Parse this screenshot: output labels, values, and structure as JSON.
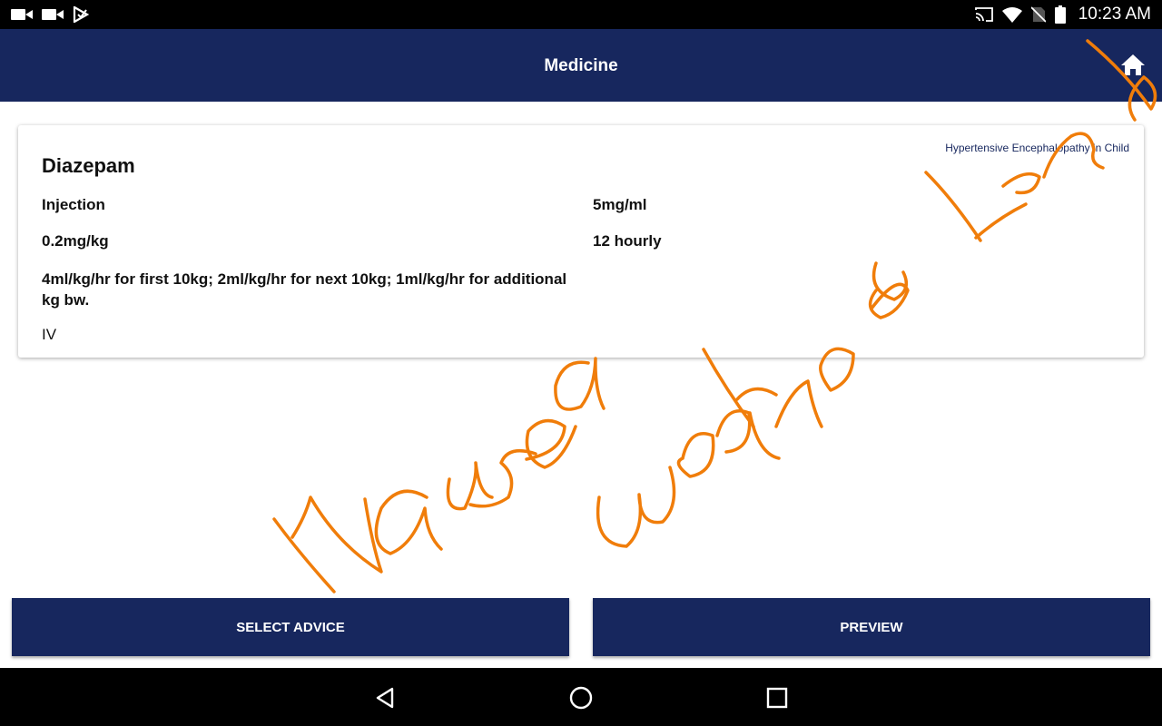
{
  "status_bar": {
    "time": "10:23 AM",
    "left_icons": [
      "video-notification-icon",
      "video-notification-icon",
      "play-store-notification-icon"
    ],
    "right_icons": [
      "cast-icon",
      "wifi-icon",
      "no-sim-icon",
      "battery-icon"
    ]
  },
  "app_bar": {
    "title": "Medicine",
    "home_icon": "home-icon"
  },
  "medicine_card": {
    "diagnosis": "Hypertensive Encephalopathy in Child",
    "name": "Diazepam",
    "form": "Injection",
    "strength": "5mg/ml",
    "dose": "0.2mg/kg",
    "frequency": "12 hourly",
    "notes": "4ml/kg/hr for first 10kg; 2ml/kg/hr for next 10kg; 1ml/kg/hr for additional kg bw.",
    "route": "IV"
  },
  "buttons": {
    "select_advice": "SELECT ADVICE",
    "preview": "PREVIEW"
  },
  "handwriting": {
    "words": [
      "Nausea",
      "weakness Limb"
    ],
    "color": "#f07d0a"
  },
  "nav_bar": {
    "icons": [
      "back-icon",
      "home-circle-icon",
      "recent-apps-icon"
    ]
  },
  "colors": {
    "primary": "#17275e",
    "annotation": "#f07d0a"
  }
}
